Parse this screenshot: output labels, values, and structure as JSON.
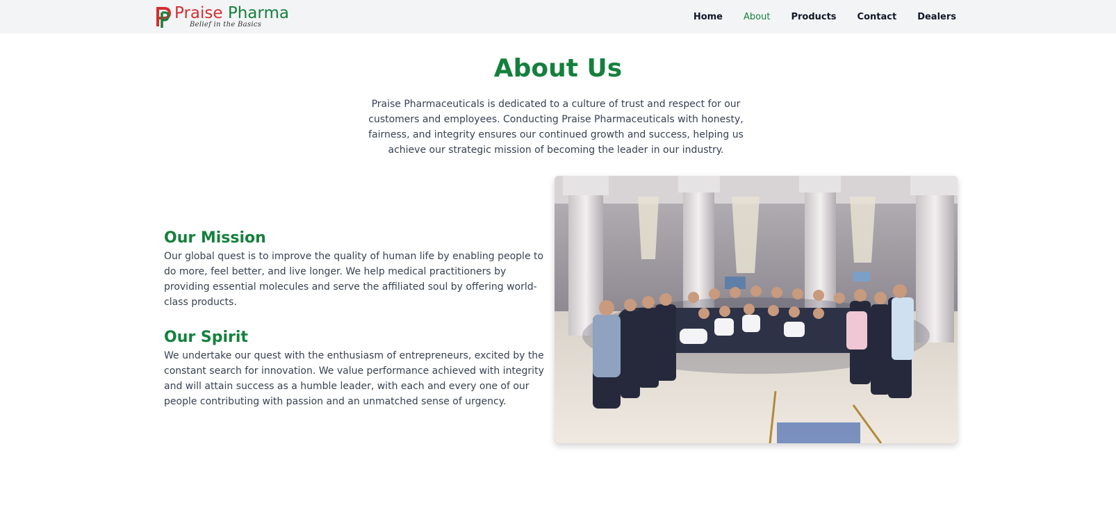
{
  "brand": {
    "name_part1": "Praise",
    "name_part2": "Pharma",
    "tagline": "Belief in the Basics"
  },
  "nav": {
    "items": [
      {
        "label": "Home",
        "active": false
      },
      {
        "label": "About",
        "active": true
      },
      {
        "label": "Products",
        "active": false
      },
      {
        "label": "Contact",
        "active": false
      },
      {
        "label": "Dealers",
        "active": false
      }
    ]
  },
  "page": {
    "title": "About Us",
    "intro": "Praise Pharmaceuticals is dedicated to a culture of trust and respect for our customers and employees. Conducting Praise Pharmaceuticals with honesty, fairness, and integrity ensures our continued growth and success, helping us achieve our strategic mission of becoming the leader in our industry."
  },
  "mission": {
    "heading": "Our Mission",
    "body": "Our global quest is to improve the quality of human life by enabling people to do more, feel better, and live longer. We help medical practitioners by providing essential molecules and serve the affiliated soul by offering world-class products."
  },
  "spirit": {
    "heading": "Our Spirit",
    "body": "We undertake our quest with the enthusiasm of entrepreneurs, excited by the constant search for innovation. We value performance achieved with integrity and will attain success as a humble leader, with each and every one of our people contributing with passion and an unmatched sense of urgency."
  },
  "colors": {
    "brand_green": "#15803d",
    "brand_red": "#d32f2f",
    "nav_bg": "#f3f4f6"
  }
}
